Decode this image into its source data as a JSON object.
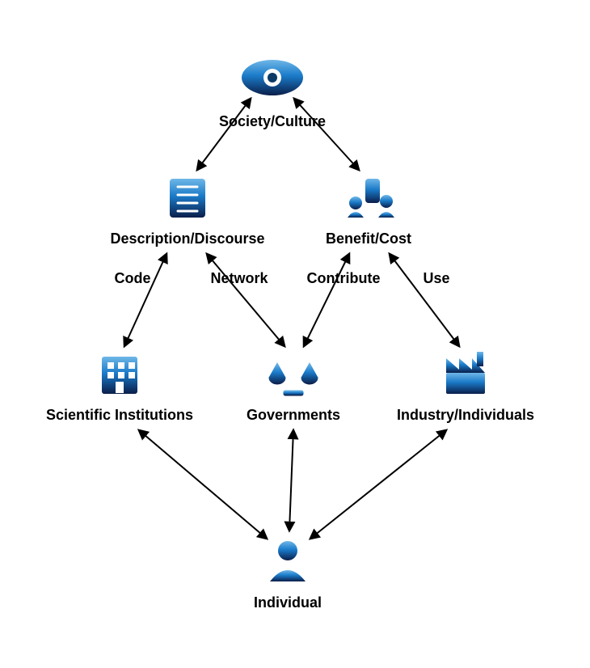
{
  "diagram": {
    "root": {
      "label": "Society/Culture"
    },
    "level2": {
      "left": {
        "label": "Description/Discourse"
      },
      "right": {
        "label": "Benefit/Cost"
      }
    },
    "edge_sub": {
      "ll": "Code",
      "lr": "Network",
      "rl": "Contribute",
      "rr": "Use"
    },
    "level3": {
      "left": {
        "label": "Scientific Institutions"
      },
      "center": {
        "label": "Governments"
      },
      "right": {
        "label": "Industry/Individuals"
      }
    },
    "bottom": {
      "label": "Individual"
    }
  }
}
